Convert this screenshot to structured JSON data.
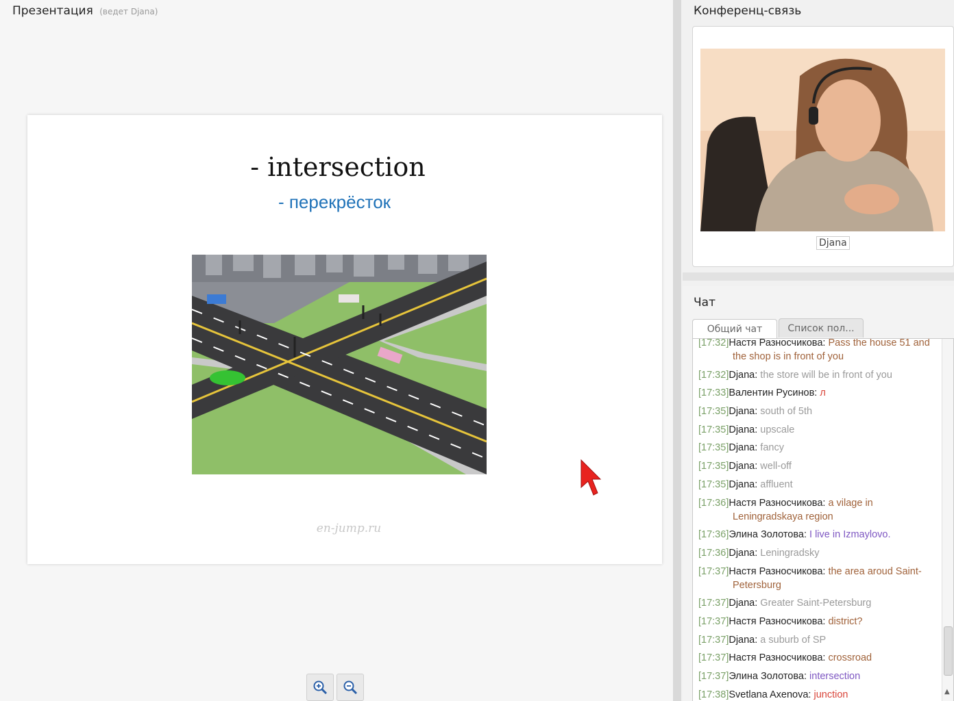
{
  "presentation": {
    "title": "Презентация",
    "presenter": "(ведет Djana)",
    "slide": {
      "title": "- intersection",
      "subtitle": "- перекрёсток",
      "watermark": "en-jump.ru"
    },
    "zoom_in_icon": "zoom-in-icon",
    "zoom_out_icon": "zoom-out-icon"
  },
  "conference": {
    "title": "Конференц-связь",
    "participant_label": "Djana"
  },
  "chat": {
    "title": "Чат",
    "tabs": [
      {
        "label": "Общий чат",
        "active": true
      },
      {
        "label": "Список пол...",
        "active": false
      }
    ],
    "messages": [
      {
        "time": "[17:32]",
        "user": "Настя Разносчикова:",
        "text": "Pass the house 51 and the shop is in front of you",
        "color": "#a0623a"
      },
      {
        "time": "[17:32]",
        "user": "Djana:",
        "text": "the store will be in front of you",
        "color": "#9a9a9a"
      },
      {
        "time": "[17:33]",
        "user": "Валентин Русинов:",
        "text": "л",
        "color": "#d9453a"
      },
      {
        "time": "[17:35]",
        "user": "Djana:",
        "text": "south of 5th",
        "color": "#9a9a9a"
      },
      {
        "time": "[17:35]",
        "user": "Djana:",
        "text": "upscale",
        "color": "#9a9a9a"
      },
      {
        "time": "[17:35]",
        "user": "Djana:",
        "text": "fancy",
        "color": "#9a9a9a"
      },
      {
        "time": "[17:35]",
        "user": "Djana:",
        "text": "well-off",
        "color": "#9a9a9a"
      },
      {
        "time": "[17:35]",
        "user": "Djana:",
        "text": "affluent",
        "color": "#9a9a9a"
      },
      {
        "time": "[17:36]",
        "user": "Настя Разносчикова:",
        "text": "a vilage in Leningradskaya region",
        "color": "#a0623a"
      },
      {
        "time": "[17:36]",
        "user": "Элина Золотова:",
        "text": "I live in Izmaylovo.",
        "color": "#7e57c2"
      },
      {
        "time": "[17:36]",
        "user": "Djana:",
        "text": "Leningradsky",
        "color": "#9a9a9a"
      },
      {
        "time": "[17:37]",
        "user": "Настя Разносчикова:",
        "text": "the area aroud Saint-Petersburg",
        "color": "#a0623a"
      },
      {
        "time": "[17:37]",
        "user": "Djana:",
        "text": "Greater Saint-Petersburg",
        "color": "#9a9a9a"
      },
      {
        "time": "[17:37]",
        "user": "Настя Разносчикова:",
        "text": "district?",
        "color": "#a0623a"
      },
      {
        "time": "[17:37]",
        "user": "Djana:",
        "text": "a suburb of SP",
        "color": "#9a9a9a"
      },
      {
        "time": "[17:37]",
        "user": "Настя Разносчикова:",
        "text": "crossroad",
        "color": "#a0623a"
      },
      {
        "time": "[17:37]",
        "user": "Элина Золотова:",
        "text": "intersection",
        "color": "#7e57c2"
      },
      {
        "time": "[17:38]",
        "user": "Svetlana Axenova:",
        "text": "junction",
        "color": "#d9453a"
      }
    ]
  }
}
